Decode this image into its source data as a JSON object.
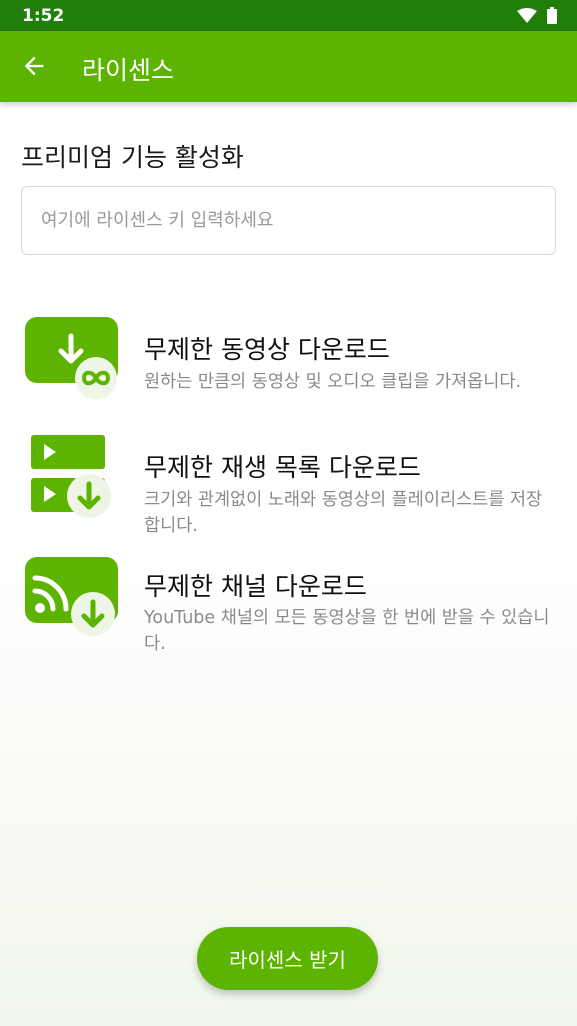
{
  "status_bar": {
    "time": "1:52"
  },
  "app_bar": {
    "title": "라이센스",
    "back_icon": "arrow-left-icon"
  },
  "premium": {
    "title": "프리미엄 기능 활성화",
    "input_placeholder": "여기에 라이센스 키 입력하세요",
    "input_value": ""
  },
  "features": [
    {
      "icon": "video-download-infinity-icon",
      "title": "무제한 동영상 다운로드",
      "description": "원하는 만큼의 동영상 및 오디오 클립을 가져옵니다."
    },
    {
      "icon": "playlist-download-icon",
      "title": "무제한 재생 목록 다운로드",
      "description": "크기와 관계없이 노래와 동영상의 플레이리스트를 저장합니다."
    },
    {
      "icon": "channel-download-icon",
      "title": "무제한 채널 다운로드",
      "description": "YouTube 채널의 모든 동영상을 한 번에 받을 수 있습니다."
    }
  ],
  "actions": {
    "get_license_label": "라이센스 받기"
  },
  "colors": {
    "accent": "#5cb400",
    "status_bar": "#1f7f0a",
    "badge": "#eef4e6"
  }
}
